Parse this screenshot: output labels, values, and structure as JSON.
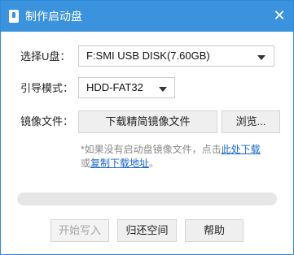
{
  "window": {
    "title": "制作启动盘",
    "close_glyph": "✕",
    "app_icon": "usb-drive-icon",
    "accent_color": "#3a93dc"
  },
  "form": {
    "usb_label": "选择U盘：",
    "usb_selected": "F:SMI USB DISK(7.60GB)",
    "boot_mode_label": "引导模式：",
    "boot_mode_selected": "HDD-FAT32",
    "image_label": "镜像文件：",
    "download_image_button": "下载精简镜像文件",
    "browse_button": "浏览..."
  },
  "hint": {
    "prefix": "*如果没有启动盘镜像文件，点击",
    "link_download": "此处下载",
    "middle": "或",
    "link_copy": "复制下载地址",
    "suffix": "。"
  },
  "progress": {
    "value": 0
  },
  "actions": {
    "start_write": "开始写入",
    "restore_space": "归还空间",
    "help": "帮助"
  }
}
